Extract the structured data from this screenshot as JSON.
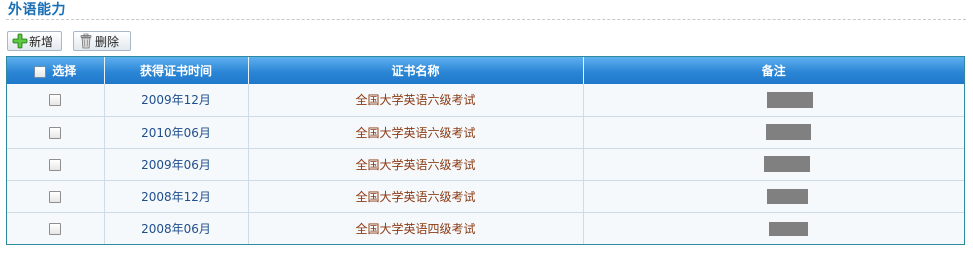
{
  "section": {
    "title": "外语能力"
  },
  "toolbar": {
    "add_label": "新增",
    "delete_label": "删除"
  },
  "table": {
    "columns": [
      "选择",
      "获得证书时间",
      "证书名称",
      "备注"
    ],
    "rows": [
      {
        "date": "2009年12月",
        "certificate": "全国大学英语六级考试",
        "note_redacted": true
      },
      {
        "date": "2010年06月",
        "certificate": "全国大学英语六级考试",
        "note_redacted": true
      },
      {
        "date": "2009年06月",
        "certificate": "全国大学英语六级考试",
        "note_redacted": true
      },
      {
        "date": "2008年12月",
        "certificate": "全国大学英语六级考试",
        "note_redacted": true
      },
      {
        "date": "2008年06月",
        "certificate": "全国大学英语四级考试",
        "note_redacted": true
      }
    ]
  },
  "icons": {
    "add": "plus-icon",
    "delete": "trash-icon"
  },
  "colors": {
    "title": "#1a6fb5",
    "header": "#2c86d6",
    "date_text": "#1f4e8c",
    "cert_text": "#8b3a12",
    "redaction": "#808080"
  }
}
